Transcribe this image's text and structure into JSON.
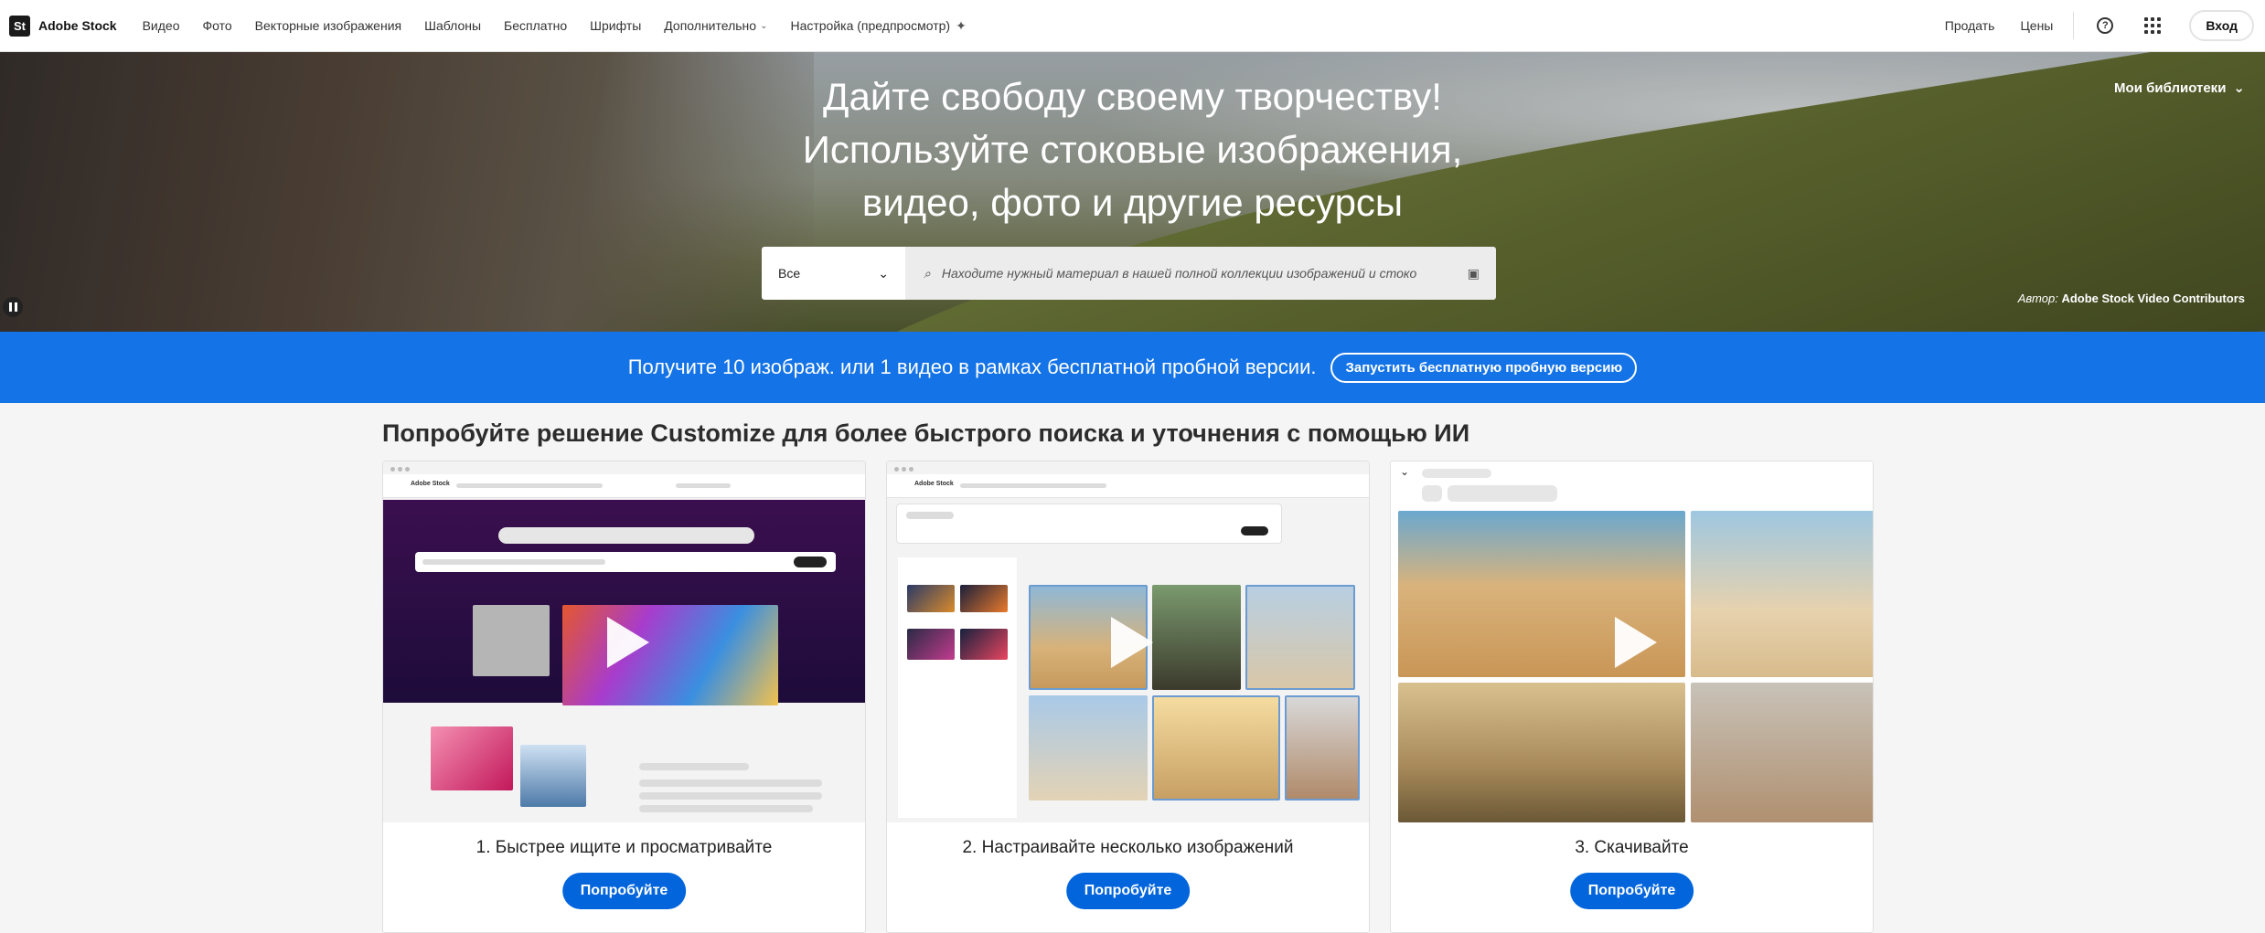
{
  "header": {
    "logo_mark": "St",
    "logo_text": "Adobe Stock",
    "nav": [
      "Видео",
      "Фото",
      "Векторные изображения",
      "Шаблоны",
      "Бесплатно",
      "Шрифты"
    ],
    "more_label": "Дополнительно",
    "customize_label": "Настройка (предпросмотр)",
    "sell_label": "Продать",
    "pricing_label": "Цены",
    "help_glyph": "?",
    "signin_label": "Вход",
    "icons": [
      "help-icon",
      "app-switcher-icon",
      "sparkle-icon",
      "chevron-down-icon"
    ]
  },
  "hero": {
    "title_lines": [
      "Дайте свободу своему творчеству!",
      "Используйте стоковые изображения,",
      "видео, фото и другие ресурсы"
    ],
    "my_libraries": "Мои библиотеки",
    "search": {
      "category": "Все",
      "placeholder": "Находите нужный материал в нашей полной коллекции изображений и стоко"
    },
    "credit_prefix": "Автор:",
    "credit_name": "Adobe Stock Video Contributors"
  },
  "promo": {
    "text": "Получите 10 изображ. или 1 видео в рамках бесплатной пробной версии.",
    "button": "Запустить бесплатную пробную версию"
  },
  "section": {
    "title": "Попробуйте решение Customize для более быстрого поиска и уточнения с помощью ИИ",
    "cards": [
      {
        "title": "1. Быстрее ищите и просматривайте",
        "button": "Попробуйте"
      },
      {
        "title": "2. Настраивайте несколько изображений",
        "button": "Попробуйте"
      },
      {
        "title": "3. Скачивайте",
        "button": "Попробуйте"
      }
    ],
    "mini_logo": "Adobe Stock"
  },
  "colors": {
    "accent_blue": "#1473e6",
    "button_blue": "#0265dc"
  }
}
